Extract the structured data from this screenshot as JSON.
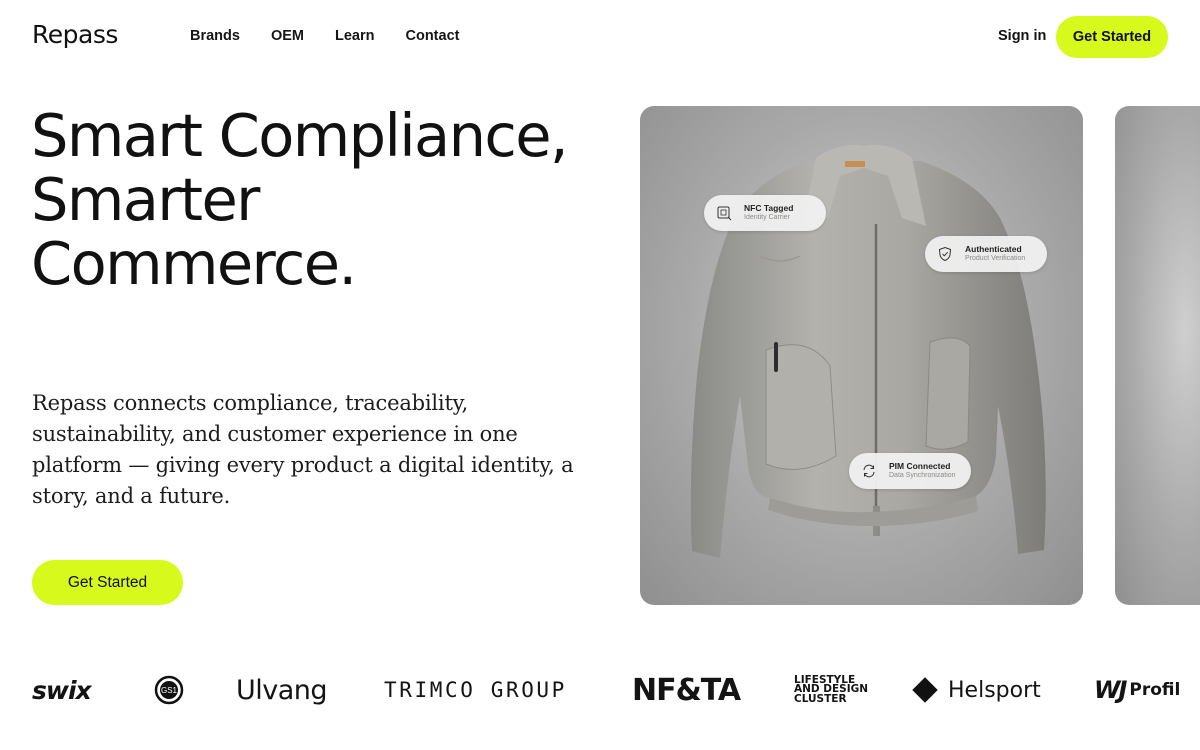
{
  "nav": {
    "logo": "Repass",
    "links": [
      "Brands",
      "OEM",
      "Learn",
      "Contact"
    ],
    "sign_in": "Sign in",
    "cta": "Get Started"
  },
  "hero": {
    "headline_lines": [
      "Smart Compliance,",
      "Smarter",
      "Commerce."
    ],
    "lead": "Repass connects compliance, traceability, sustainability, and customer experience in one platform — giving every product a digital identity, a story, and a future.",
    "cta": "Get Started"
  },
  "product_card": {
    "tags": [
      {
        "title": "NFC Tagged",
        "subtitle": "Identity Carrier",
        "icon": "nfc-chip-icon"
      },
      {
        "title": "Authenticated",
        "subtitle": "Product Verification",
        "icon": "shield-check-icon"
      },
      {
        "title": "PIM Connected",
        "subtitle": "Data Synchronization",
        "icon": "sync-icon"
      }
    ]
  },
  "brand_logos": {
    "swix": "swix",
    "gs1": "GS1",
    "ulvang": "Ulvang",
    "trimco": "TRIMCO GROUP",
    "nfta": "NF&TA",
    "lifestyle": [
      "LIFESTYLE",
      "AND DESIGN",
      "CLUSTER"
    ],
    "helsport": "Helsport",
    "profil_mark": "WJ",
    "profil": "Profil"
  },
  "colors": {
    "accent": "#d8f91c",
    "text": "#111111",
    "card_bg": "#a9a9a9"
  }
}
